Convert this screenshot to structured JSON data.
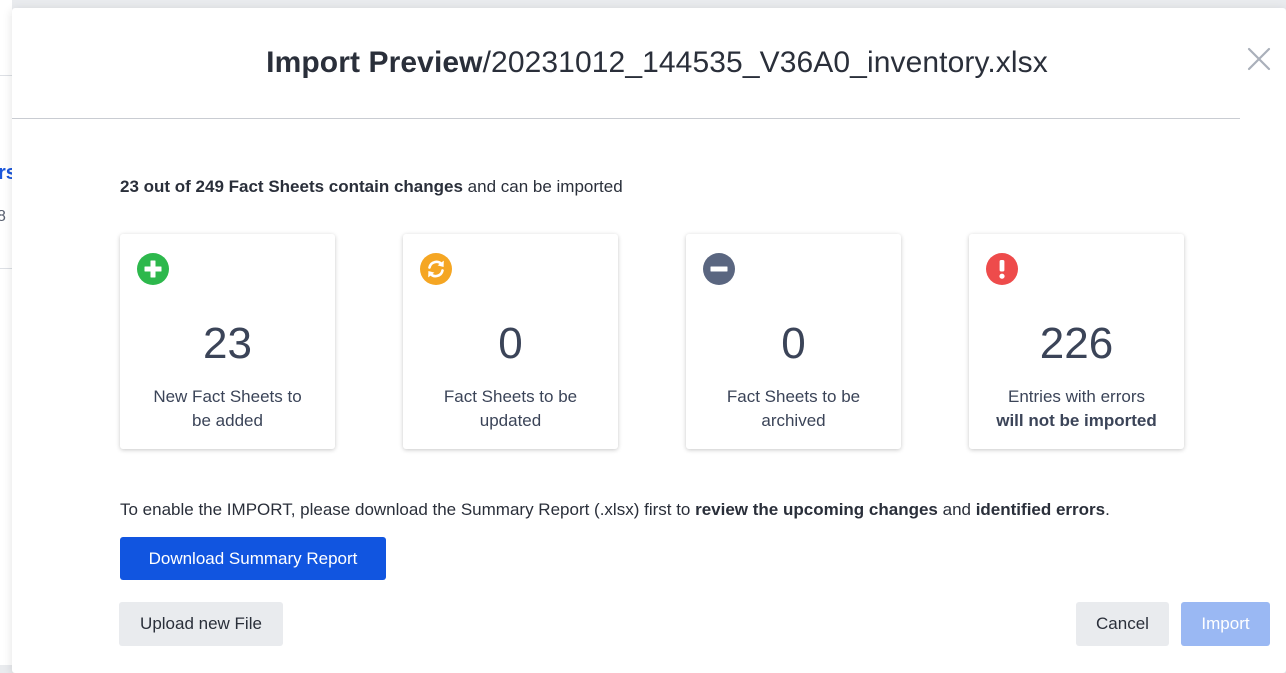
{
  "background": {
    "glimpse_1": "rs",
    "glimpse_2": "8"
  },
  "modal": {
    "title_bold": "Import Preview",
    "title_rest": "/20231012_144535_V36A0_inventory.xlsx",
    "close_icon": "close-icon"
  },
  "summary": {
    "bold": "23 out of 249 Fact Sheets contain changes",
    "rest": " and can be imported"
  },
  "cards": [
    {
      "icon": "plus-circle-icon",
      "color": "#2db84c",
      "count": "23",
      "line1": "New Fact Sheets to",
      "line2": "be added"
    },
    {
      "icon": "refresh-circle-icon",
      "color": "#f5a623",
      "count": "0",
      "line1": "Fact Sheets to be",
      "line2": "updated"
    },
    {
      "icon": "minus-circle-icon",
      "color": "#5a6680",
      "count": "0",
      "line1": "Fact Sheets to be",
      "line2": "archived"
    },
    {
      "icon": "exclamation-circle-icon",
      "color": "#ee4b4b",
      "count": "226",
      "line1": "Entries with errors",
      "line2": "will not be imported"
    }
  ],
  "enable": {
    "part1": "To enable the IMPORT, please download the Summary Report (.xlsx) first to ",
    "bold1": "review the upcoming changes",
    "part2": " and ",
    "bold2": "identified errors",
    "part3": "."
  },
  "buttons": {
    "download": "Download Summary Report",
    "upload": "Upload new File",
    "cancel": "Cancel",
    "import": "Import"
  },
  "colors": {
    "primary": "#1155e0",
    "primary_disabled": "#9ab8f3",
    "secondary_bg": "#e9ebee"
  }
}
